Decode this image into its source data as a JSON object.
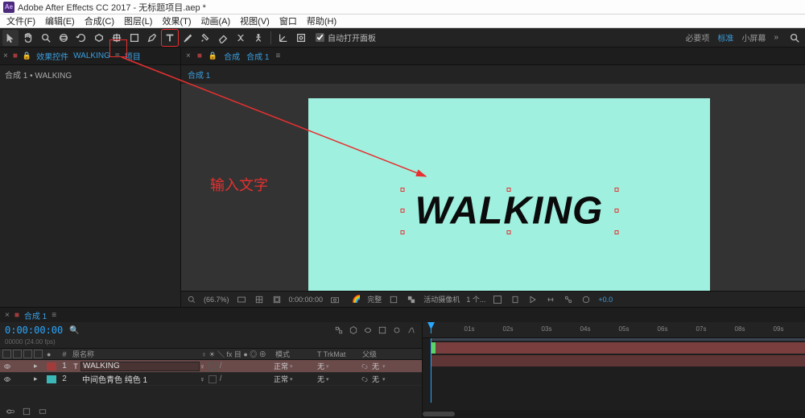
{
  "window": {
    "title": "Adobe After Effects CC 2017 - 无标题项目.aep *"
  },
  "menus": [
    "文件(F)",
    "编辑(E)",
    "合成(C)",
    "图层(L)",
    "效果(T)",
    "动画(A)",
    "视图(V)",
    "窗口",
    "帮助(H)"
  ],
  "toolbar": {
    "snap_label": "自动打开面板"
  },
  "topright": {
    "req": "必要项",
    "std": "标准",
    "small": "小屏幕"
  },
  "left_panel": {
    "tab_controls": "效果控件",
    "tab_subject": "WALKING",
    "tab_project": "项目",
    "breadcrumb_a": "合成 1",
    "breadcrumb_b": "WALKING"
  },
  "mid_panel": {
    "tab_label_a": "合成",
    "tab_label_b": "合成 1",
    "link": "合成 1"
  },
  "canvas": {
    "text": "WALKING"
  },
  "viewer_footer": {
    "zoom": "(66.7%)",
    "time": "0:00:00:00",
    "full": "完整",
    "cam": "活动摄像机",
    "views": "1 个...",
    "exp": "+0.0"
  },
  "timeline": {
    "tab_a": "合成 1",
    "timecode": "0:00:00:00",
    "subtime": "00000 (24.00 fps)",
    "cols": {
      "name": "原名称",
      "switches": "♀ ☀ ＼ fx 目 ● ◎ ⊕",
      "mode": "模式",
      "trk": "T  TrkMat",
      "parent": "父级"
    },
    "rows": [
      {
        "num": "1",
        "type": "T",
        "name": "WALKING",
        "mode": "正常",
        "trk": "无",
        "parent": "无",
        "labelClass": "red",
        "selected": true,
        "boxed": true
      },
      {
        "num": "2",
        "type": "",
        "name": "中间色青色 纯色 1",
        "mode": "正常",
        "trk": "无",
        "parent": "无",
        "labelClass": "cyan",
        "selected": false,
        "boxed": false
      }
    ],
    "ruler": [
      "01s",
      "02s",
      "03s",
      "04s",
      "05s",
      "06s",
      "07s",
      "08s",
      "09s"
    ]
  },
  "annotation": {
    "text": "输入文字"
  }
}
